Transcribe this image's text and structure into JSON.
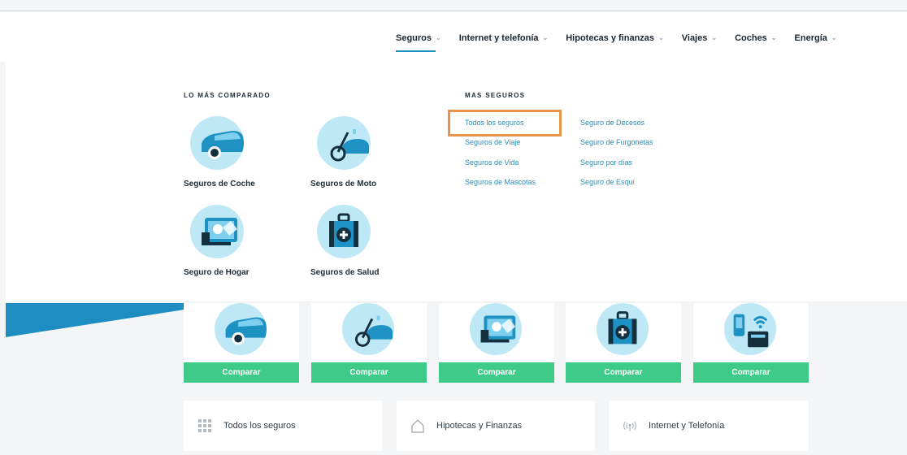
{
  "nav": {
    "items": [
      {
        "label": "Seguros",
        "icon": "chevron-down-icon"
      },
      {
        "label": "Internet y telefonía",
        "icon": "chevron-down-icon"
      },
      {
        "label": "Hipotecas y finanzas",
        "icon": "chevron-down-icon"
      },
      {
        "label": "Viajes",
        "icon": "chevron-down-icon"
      },
      {
        "label": "Coches",
        "icon": "chevron-down-icon"
      },
      {
        "label": "Energía",
        "icon": "chevron-down-icon"
      }
    ],
    "chevron": "⌄"
  },
  "mega_menu": {
    "most_compared_title": "LO MÁS COMPARADO",
    "more_title": "MAS SEGUROS",
    "products": [
      {
        "label": "Seguros de Coche",
        "icon": "car-icon"
      },
      {
        "label": "Seguros de Moto",
        "icon": "scooter-icon"
      },
      {
        "label": "Seguro de Hogar",
        "icon": "home-photo-icon"
      },
      {
        "label": "Seguros de Salud",
        "icon": "medical-kit-icon"
      }
    ],
    "links_col1": [
      "Todos los seguros",
      "Seguros de Viaje",
      "Seguros de Vida",
      "Seguros de Mascotas"
    ],
    "links_col2": [
      "Seguro de Decesos",
      "Seguro de Furgonetas",
      "Seguro por días",
      "Seguro de Esquí"
    ]
  },
  "cards": {
    "button_label": "Comparar",
    "icons": [
      "car-icon",
      "scooter-icon",
      "home-photo-icon",
      "medical-kit-icon",
      "phone-wifi-icon"
    ]
  },
  "bottom_links": [
    {
      "label": "Todos los seguros",
      "icon": "grid-icon"
    },
    {
      "label": "Hipotecas y Finanzas",
      "icon": "house-outline-icon"
    },
    {
      "label": "Internet y Telefonía",
      "icon": "antenna-icon"
    }
  ],
  "colors": {
    "accent_blue": "#1e8ec2",
    "link_blue": "#2a8fb8",
    "compare_green": "#3ecb8a",
    "icon_bg": "#bfe8f7",
    "highlight_orange": "#e8934a"
  }
}
